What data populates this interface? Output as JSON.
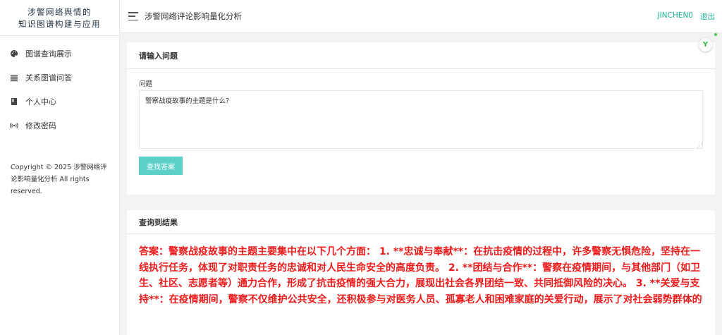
{
  "sidebar": {
    "brand_line1": "涉警网络舆情的",
    "brand_line2": "知识图谱构建与应用",
    "items": [
      {
        "label": "图谱查询展示",
        "icon": "palette-icon"
      },
      {
        "label": "关系图谱问答",
        "icon": "list-icon"
      },
      {
        "label": "个人中心",
        "icon": "book-icon"
      },
      {
        "label": "修改密码",
        "icon": "broadcast-icon"
      }
    ],
    "copyright": "Copyright © 2025 涉警网络评论影响量化分析 All rights reserved."
  },
  "topbar": {
    "title": "涉警网络评论影响量化分析",
    "username": "JINCHEN0",
    "logout": "退出"
  },
  "query_card": {
    "title": "请输入问题",
    "field_label": "问题",
    "question_value": "警察战疫故事的主题是什么?",
    "submit_label": "查找答案"
  },
  "result_card": {
    "title": "查询到结果",
    "answer": "答案：警察战疫故事的主题主要集中在以下几个方面： 1. **忠诚与奉献**：在抗击疫情的过程中，许多警察无惧危险，坚持在一线执行任务，体现了对职责任务的忠诚和对人民生命安全的高度负责。 2. **团结与合作**：警察在疫情期间，与其他部门（如卫生、社区、志愿者等）通力合作，形成了抗击疫情的强大合力，展现出社会各界团结一致、共同抵御风险的决心。 3. **关爱与支持**：在疫情期间，警察不仅维护公共安全，还积极参与对医务人员、孤寡老人和困难家庭的关爱行动，展示了对社会弱势群体的"
  },
  "floating": {
    "badge_glyph": "Y"
  },
  "colors": {
    "accent": "#1ab394",
    "button": "#5ccfc9",
    "answer": "#ed1b1b"
  }
}
